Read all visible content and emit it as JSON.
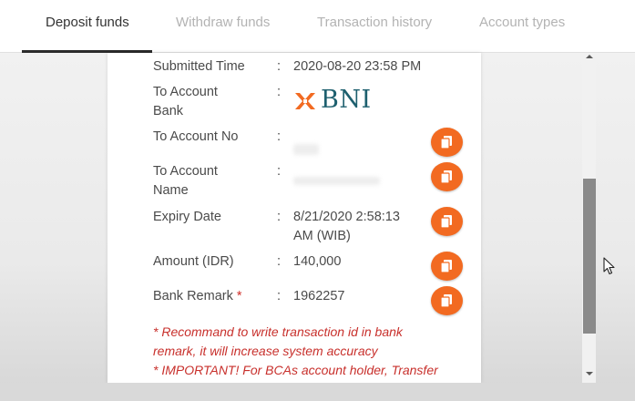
{
  "tabs": [
    {
      "label": "Deposit funds",
      "active": true
    },
    {
      "label": "Withdraw funds",
      "active": false
    },
    {
      "label": "Transaction history",
      "active": false
    },
    {
      "label": "Account types",
      "active": false
    }
  ],
  "details": {
    "submitted_time_label": "Submitted Time",
    "submitted_time_value": "2020-08-20 23:58 PM",
    "to_account_bank_label_1": "To Account",
    "to_account_bank_label_2": "Bank",
    "bank_logo_text": "BNI",
    "to_account_no_label": "To Account No",
    "to_account_name_label_1": "To Account",
    "to_account_name_label_2": "Name",
    "expiry_date_label": "Expiry Date",
    "expiry_date_value_1": "8/21/2020 2:58:13",
    "expiry_date_value_2": "AM (WIB)",
    "amount_label": "Amount (IDR)",
    "amount_value": "140,000",
    "bank_remark_label": "Bank Remark",
    "bank_remark_required": "*",
    "bank_remark_value": "1962257",
    "colon": ":"
  },
  "notes": {
    "line1": "* Recommand to write transaction id in bank",
    "line2": "remark, it will increase system accuracy",
    "line3": "* IMPORTANT! For BCAs account holder, Transfer"
  },
  "colors": {
    "accent_orange": "#f26a21",
    "bni_teal": "#1d5f6e",
    "note_red": "#c8302c",
    "active_tab": "#333333",
    "inactive_tab": "#b3b3b3"
  },
  "icons": {
    "copy": "copy-icon",
    "bank_logo": "bni-logo-icon",
    "cursor": "mouse-pointer-icon"
  }
}
